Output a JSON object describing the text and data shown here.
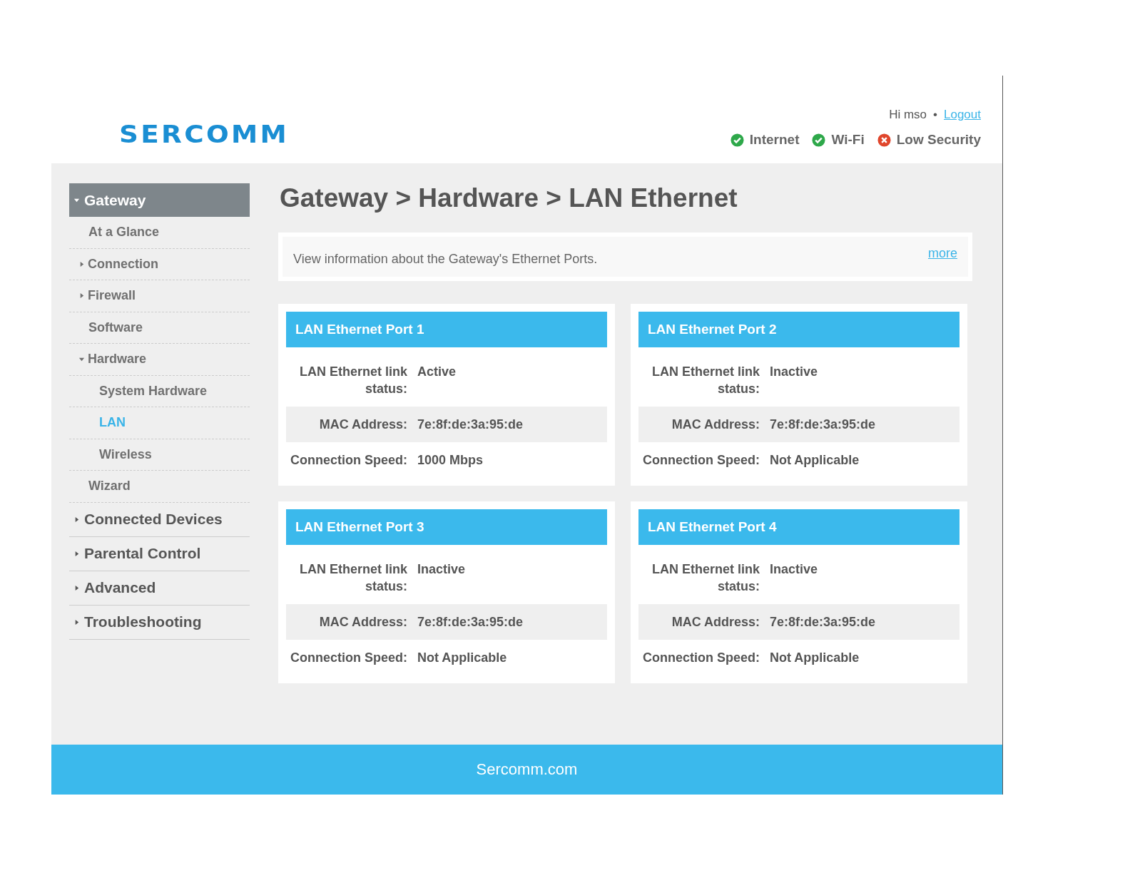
{
  "header": {
    "logo": "SERCOMM",
    "greeting": "Hi mso",
    "separator": "•",
    "logout": "Logout",
    "status": [
      {
        "label": "Internet",
        "ok": true
      },
      {
        "label": "Wi-Fi",
        "ok": true
      },
      {
        "label": "Low Security",
        "ok": false
      }
    ]
  },
  "nav": [
    {
      "label": "Gateway",
      "kind": "group",
      "expanded": true,
      "selected": false,
      "children": [
        {
          "label": "At a Glance",
          "kind": "page",
          "selected": false
        },
        {
          "label": "Connection",
          "kind": "group",
          "expanded": false,
          "selected": false
        },
        {
          "label": "Firewall",
          "kind": "group",
          "expanded": false,
          "selected": false
        },
        {
          "label": "Software",
          "kind": "page",
          "selected": false
        },
        {
          "label": "Hardware",
          "kind": "group",
          "expanded": true,
          "selected": false,
          "children": [
            {
              "label": "System Hardware",
              "selected": false
            },
            {
              "label": "LAN",
              "selected": true
            },
            {
              "label": "Wireless",
              "selected": false
            }
          ]
        },
        {
          "label": "Wizard",
          "kind": "page",
          "selected": false
        }
      ]
    },
    {
      "label": "Connected Devices",
      "kind": "group",
      "expanded": false,
      "selected": false
    },
    {
      "label": "Parental Control",
      "kind": "group",
      "expanded": false,
      "selected": false
    },
    {
      "label": "Advanced",
      "kind": "group",
      "expanded": false,
      "selected": false
    },
    {
      "label": "Troubleshooting",
      "kind": "group",
      "expanded": false,
      "selected": false
    }
  ],
  "page_title": "Gateway > Hardware > LAN Ethernet",
  "info": {
    "text": "View information about the Gateway's Ethernet Ports.",
    "link": "more"
  },
  "ports": [
    {
      "title": "LAN Ethernet Port 1",
      "rows": [
        {
          "label": "LAN Ethernet link status:",
          "value": "Active"
        },
        {
          "label": "MAC Address:",
          "value": "7e:8f:de:3a:95:de"
        },
        {
          "label": "Connection Speed:",
          "value": "1000 Mbps"
        }
      ]
    },
    {
      "title": "LAN Ethernet Port 2",
      "rows": [
        {
          "label": "LAN Ethernet link status:",
          "value": "Inactive"
        },
        {
          "label": "MAC Address:",
          "value": "7e:8f:de:3a:95:de"
        },
        {
          "label": "Connection Speed:",
          "value": "Not Applicable"
        }
      ]
    },
    {
      "title": "LAN Ethernet Port 3",
      "rows": [
        {
          "label": "LAN Ethernet link status:",
          "value": "Inactive"
        },
        {
          "label": "MAC Address:",
          "value": "7e:8f:de:3a:95:de"
        },
        {
          "label": "Connection Speed:",
          "value": "Not Applicable"
        }
      ]
    },
    {
      "title": "LAN Ethernet Port 4",
      "rows": [
        {
          "label": "LAN Ethernet link status:",
          "value": "Inactive"
        },
        {
          "label": "MAC Address:",
          "value": "7e:8f:de:3a:95:de"
        },
        {
          "label": "Connection Speed:",
          "value": "Not Applicable"
        }
      ]
    }
  ],
  "footer": "Sercomm.com"
}
